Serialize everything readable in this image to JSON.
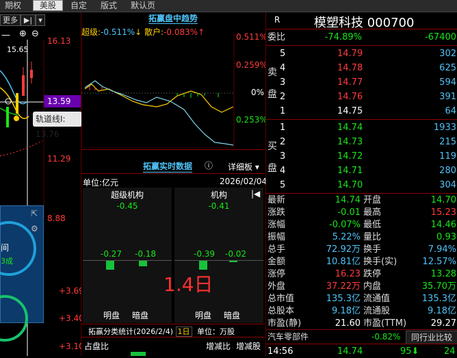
{
  "topbar": {
    "tabs": [
      "期权",
      "美股",
      "自定",
      "版式",
      "默认页"
    ]
  },
  "leftpane": {
    "more_btn": "更多",
    "price_axis": [
      "16.13",
      "13.59",
      "11.29",
      "8.88",
      "+3.69",
      "+3.40",
      "+3.10"
    ],
    "current_price_label": "15.65",
    "tooltip": "轨道线I: 13.76",
    "widget_text1": "间",
    "widget_text2": "3成"
  },
  "trend": {
    "title": "拓赢盘中趋势",
    "super_label": "超级:",
    "super_value": "-0.511%",
    "retail_label": "散户:",
    "retail_value": "-0.083%",
    "axis_right": [
      "0.511%",
      "0.259%",
      "0%",
      "0.253%"
    ]
  },
  "realtime": {
    "title": "拓赢实时数据",
    "detail_btn": "详细板",
    "unit": "单位:亿元",
    "date": "2026/02/04",
    "super": {
      "title": "超级机构",
      "total": "-0.45",
      "bright": "-0.27",
      "dark": "-0.18",
      "bright_label": "明盘",
      "dark_label": "暗盘"
    },
    "inst": {
      "title": "机构",
      "total": "-0.41",
      "bright": "-0.39",
      "dark": "-0.02",
      "bright_label": "明盘",
      "dark_label": "暗盘"
    },
    "watermark": "1.4日"
  },
  "classify": {
    "title": "拓赢分类统计(2026/2/4)",
    "period": "1日",
    "unit_label": "单位：",
    "unit_value": "万股",
    "col1": "占盘比",
    "col2": "增减比",
    "col3": "增减股"
  },
  "stock": {
    "marker": "R",
    "name": "模塑科技",
    "code": "000700",
    "weibi_label": "委比",
    "weibi_pct": "-74.89%",
    "weibi_val": "-67400",
    "sell_label": "卖盘",
    "buy_label": "买盘",
    "asks": [
      {
        "level": "5",
        "price": "14.79",
        "vol": "302"
      },
      {
        "level": "4",
        "price": "14.78",
        "vol": "625"
      },
      {
        "level": "3",
        "price": "14.77",
        "vol": "594"
      },
      {
        "level": "2",
        "price": "14.76",
        "vol": "391"
      },
      {
        "level": "1",
        "price": "14.75",
        "vol": "64"
      }
    ],
    "bids": [
      {
        "level": "1",
        "price": "14.74",
        "vol": "1933"
      },
      {
        "level": "2",
        "price": "14.73",
        "vol": "215"
      },
      {
        "level": "3",
        "price": "14.72",
        "vol": "119"
      },
      {
        "level": "4",
        "price": "14.71",
        "vol": "280"
      },
      {
        "level": "5",
        "price": "14.70",
        "vol": "304"
      }
    ],
    "quotes": [
      {
        "l1": "最新",
        "v1": "14.74",
        "c1": "green",
        "l2": "开盘",
        "v2": "14.70",
        "c2": "green"
      },
      {
        "l1": "涨跌",
        "v1": "-0.01",
        "c1": "green",
        "l2": "最高",
        "v2": "15.23",
        "c2": "red"
      },
      {
        "l1": "涨幅",
        "v1": "-0.07%",
        "c1": "green",
        "l2": "最低",
        "v2": "14.46",
        "c2": "green"
      },
      {
        "l1": "振幅",
        "v1": "5.22%",
        "c1": "cyan",
        "l2": "量比",
        "v2": "0.93",
        "c2": "green"
      },
      {
        "l1": "总手",
        "v1": "72.92万",
        "c1": "cyan",
        "l2": "换手",
        "v2": "7.94%",
        "c2": "cyan"
      },
      {
        "l1": "金额",
        "v1": "10.81亿",
        "c1": "cyan",
        "l2": "换手(实)",
        "v2": "12.57%",
        "c2": "cyan"
      },
      {
        "l1": "涨停",
        "v1": "16.23",
        "c1": "red",
        "l2": "跌停",
        "v2": "13.28",
        "c2": "green"
      },
      {
        "l1": "外盘",
        "v1": "37.22万",
        "c1": "red",
        "l2": "内盘",
        "v2": "35.70万",
        "c2": "green"
      },
      {
        "l1": "总市值",
        "v1": "135.3亿",
        "c1": "cyan",
        "l2": "流通值",
        "v2": "135.3亿",
        "c2": "cyan"
      },
      {
        "l1": "总股本",
        "v1": "9.18亿",
        "c1": "cyan",
        "l2": "流通股",
        "v2": "9.18亿",
        "c2": "cyan"
      },
      {
        "l1": "市盈(静)",
        "v1": "21.60",
        "c1": "white",
        "l2": "市盈(TTM)",
        "v2": "29.27",
        "c2": "white"
      }
    ],
    "industry": "汽车零部件",
    "industry_pct": "-0.82%",
    "compare_btn": "同行业比较",
    "tick": {
      "time": "14:56",
      "price": "14.74",
      "vol": "95",
      "num": "24"
    }
  }
}
